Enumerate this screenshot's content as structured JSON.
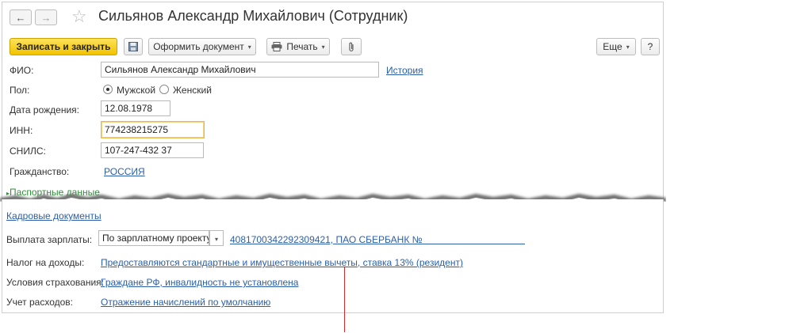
{
  "window": {
    "back_glyph": "←",
    "forward_glyph": "→",
    "star_glyph": "☆",
    "title": "Сильянов Александр Михайлович (Сотрудник)"
  },
  "toolbar": {
    "save_close": "Записать и закрыть",
    "save_icon": "floppy-disk-icon",
    "create_document": "Оформить документ",
    "print": "Печать",
    "attach_icon": "paperclip-icon",
    "more": "Еще",
    "help": "?",
    "dropdown_glyph": "▾"
  },
  "form": {
    "fio_label": "ФИО:",
    "fio_value": "Сильянов Александр Михайлович",
    "history_link": "История",
    "gender_label": "Пол:",
    "gender_male": "Мужской",
    "gender_female": "Женский",
    "gender_selected": "Мужской",
    "birth_label": "Дата рождения:",
    "birth_value": "12.08.1978",
    "inn_label": "ИНН:",
    "inn_value": "774238215275",
    "snils_label": "СНИЛС:",
    "snils_value": "107-247-432 37",
    "citizenship_label": "Гражданство:",
    "citizenship_value": "РОССИЯ",
    "passport_group": "Паспортные данные"
  },
  "bottom": {
    "hr_docs_link": "Кадровые документы",
    "salary_label": "Выплата зарплаты:",
    "salary_value": "По зарплатному проекту",
    "salary_account_link": "40817003422923​09421, ПАО СБЕРБАНК №",
    "tax_label": "Налог на доходы:",
    "tax_link": "Предоставляются стандартные и имущественные вычеты, ставка 13% (резидент)",
    "insurance_label": "Условия страхования:",
    "insurance_link": "Граждане РФ, инвалидность не установлена",
    "expenses_label": "Учет расходов:",
    "expenses_link": "Отражение начислений по умолчанию"
  },
  "colors": {
    "accent_yellow": "#f3c300",
    "link_blue": "#2b5fa8",
    "focus_border": "#e8b94a",
    "pointer_red": "#d42a2a"
  }
}
